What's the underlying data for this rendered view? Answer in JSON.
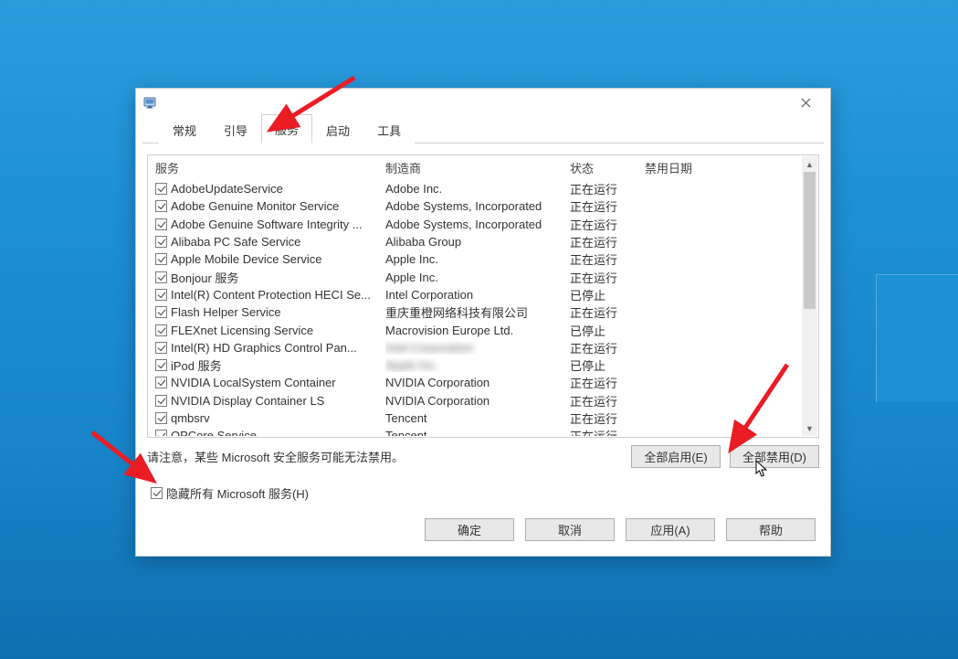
{
  "tabs": [
    "常规",
    "引导",
    "服务",
    "启动",
    "工具"
  ],
  "activeTab": 2,
  "columns": {
    "service": "服务",
    "mfr": "制造商",
    "status": "状态",
    "date": "禁用日期"
  },
  "rows": [
    {
      "checked": true,
      "name": "AdobeUpdateService",
      "mfr": "Adobe Inc.",
      "status": "正在运行",
      "blurMfr": false
    },
    {
      "checked": true,
      "name": "Adobe Genuine Monitor Service",
      "mfr": "Adobe Systems, Incorporated",
      "status": "正在运行",
      "blurMfr": false
    },
    {
      "checked": true,
      "name": "Adobe Genuine Software Integrity ...",
      "mfr": "Adobe Systems, Incorporated",
      "status": "正在运行",
      "blurMfr": false
    },
    {
      "checked": true,
      "name": "Alibaba PC Safe Service",
      "mfr": "Alibaba Group",
      "status": "正在运行",
      "blurMfr": false
    },
    {
      "checked": true,
      "name": "Apple Mobile Device Service",
      "mfr": "Apple Inc.",
      "status": "正在运行",
      "blurMfr": false
    },
    {
      "checked": true,
      "name": "Bonjour 服务",
      "mfr": "Apple Inc.",
      "status": "正在运行",
      "blurMfr": false
    },
    {
      "checked": true,
      "name": "Intel(R) Content Protection HECI Se...",
      "mfr": "Intel Corporation",
      "status": "已停止",
      "blurMfr": false
    },
    {
      "checked": true,
      "name": "Flash Helper Service",
      "mfr": "重庆重橙网络科技有限公司",
      "status": "正在运行",
      "blurMfr": false
    },
    {
      "checked": true,
      "name": "FLEXnet Licensing Service",
      "mfr": "Macrovision Europe Ltd.",
      "status": "已停止",
      "blurMfr": false
    },
    {
      "checked": true,
      "name": "Intel(R) HD Graphics Control Pan...",
      "mfr": "Intel Corporation",
      "status": "正在运行",
      "blurMfr": true
    },
    {
      "checked": true,
      "name": "iPod 服务",
      "mfr": "Apple Inc.",
      "status": "已停止",
      "blurMfr": true
    },
    {
      "checked": true,
      "name": "NVIDIA LocalSystem Container",
      "mfr": "NVIDIA Corporation",
      "status": "正在运行",
      "blurMfr": false
    },
    {
      "checked": true,
      "name": "NVIDIA Display Container LS",
      "mfr": "NVIDIA Corporation",
      "status": "正在运行",
      "blurMfr": false
    },
    {
      "checked": true,
      "name": "qmbsrv",
      "mfr": "Tencent",
      "status": "正在运行",
      "blurMfr": false
    },
    {
      "checked": true,
      "name": "QPCore Service",
      "mfr": "Tencent",
      "status": "正在运行",
      "blurMfr": false
    }
  ],
  "noteText": "请注意，某些 Microsoft 安全服务可能无法禁用。",
  "enableAll": "全部启用(E)",
  "disableAll": "全部禁用(D)",
  "hideMs": {
    "checked": true,
    "label": "隐藏所有 Microsoft 服务(H)"
  },
  "footer": {
    "ok": "确定",
    "cancel": "取消",
    "apply": "应用(A)",
    "help": "帮助"
  }
}
